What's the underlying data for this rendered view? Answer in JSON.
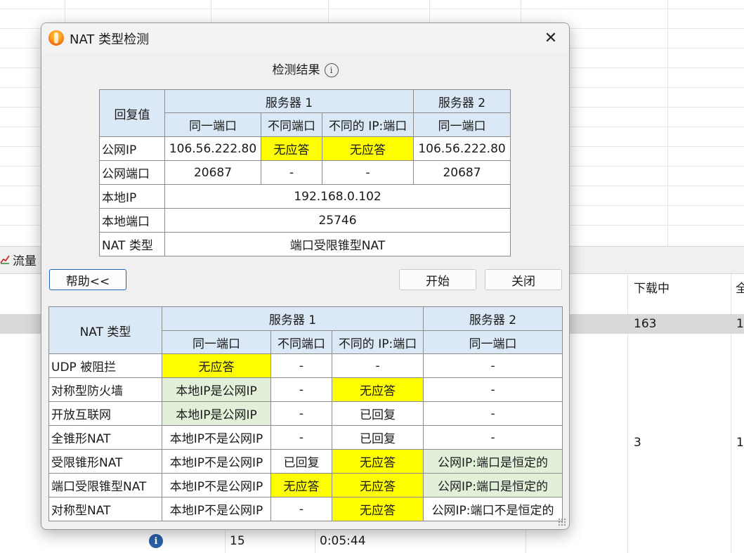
{
  "background": {
    "tab_label": "流量",
    "col_download": "下载中",
    "col_partial": "全",
    "row1": {
      "download": "163",
      "partial": "1"
    },
    "row2": {
      "download": "3",
      "partial": "1"
    },
    "bottom_row": {
      "count": "15",
      "time": "0:05:44"
    }
  },
  "dialog": {
    "title": "NAT 类型检测",
    "close_glyph": "✕",
    "result_heading": "检测结果",
    "info_glyph": "i",
    "result_table": {
      "row_header": "回复值",
      "server1": "服务器 1",
      "server2": "服务器 2",
      "sub": [
        "同一端口",
        "不同端口",
        "不同的 IP:端口",
        "同一端口"
      ],
      "rows": [
        {
          "label": "公网IP",
          "cells": [
            "106.56.222.80",
            "无应答",
            "无应答",
            "106.56.222.80"
          ]
        },
        {
          "label": "公网端口",
          "cells": [
            "20687",
            "-",
            "-",
            "20687"
          ]
        }
      ],
      "local_ip_label": "本地IP",
      "local_ip": "192.168.0.102",
      "local_port_label": "本地端口",
      "local_port": "25746",
      "nat_type_label": "NAT 类型",
      "nat_type": "端口受限锥型NAT"
    },
    "buttons": {
      "help": "帮助<<",
      "start": "开始",
      "close": "关闭"
    },
    "ref_table": {
      "row_header": "NAT 类型",
      "server1": "服务器 1",
      "server2": "服务器 2",
      "sub": [
        "同一端口",
        "不同端口",
        "不同的 IP:端口",
        "同一端口"
      ],
      "rows": [
        {
          "label": "UDP 被阻拦",
          "cells": [
            "无应答",
            "-",
            "-",
            "-"
          ]
        },
        {
          "label": "对称型防火墙",
          "cells": [
            "本地IP是公网IP",
            "-",
            "无应答",
            "-"
          ]
        },
        {
          "label": "开放互联网",
          "cells": [
            "本地IP是公网IP",
            "-",
            "已回复",
            "-"
          ]
        },
        {
          "label": "全锥形NAT",
          "cells": [
            "本地IP不是公网IP",
            "-",
            "已回复",
            "-"
          ]
        },
        {
          "label": "受限锥形NAT",
          "cells": [
            "本地IP不是公网IP",
            "已回复",
            "无应答",
            "公网IP:端口是恒定的"
          ]
        },
        {
          "label": "端口受限锥型NAT",
          "cells": [
            "本地IP不是公网IP",
            "无应答",
            "无应答",
            "公网IP:端口是恒定的"
          ]
        },
        {
          "label": "对称型NAT",
          "cells": [
            "本地IP不是公网IP",
            "-",
            "无应答",
            "公网IP:端口不是恒定的"
          ]
        }
      ]
    },
    "colors": {
      "highlight_yellow": "#ffff00",
      "highlight_green": "#e2f0d9",
      "header_blue": "#dbe8f5"
    }
  }
}
